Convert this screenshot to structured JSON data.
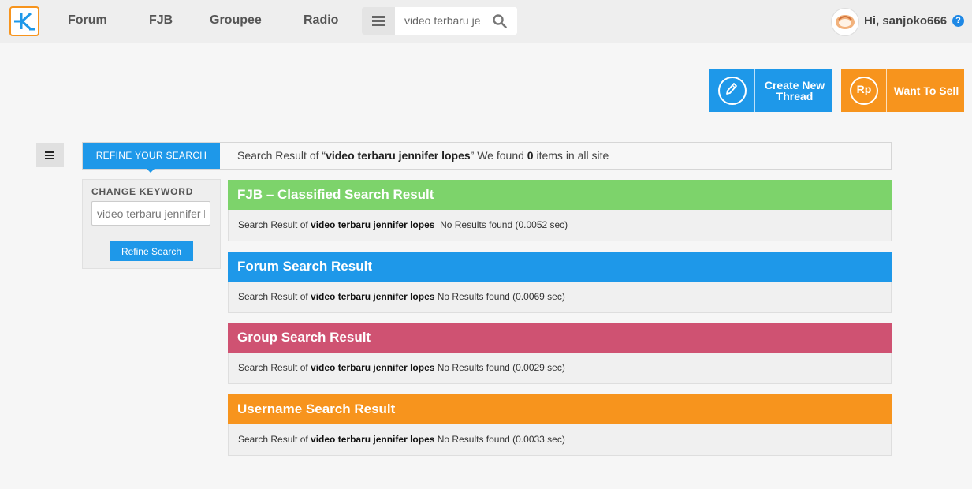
{
  "nav": {
    "logo_label": "K",
    "items": [
      "Forum",
      "FJB",
      "Groupee",
      "Radio"
    ],
    "search_value": "video terbaru je",
    "user_greeting": "Hi, sanjoko666",
    "help_label": "?"
  },
  "actions": {
    "create_line1": "Create New",
    "create_line2": "Thread",
    "sell_label": "Want To Sell",
    "sell_icon_text": "Rp"
  },
  "refine": {
    "tab_label": "REFINE YOUR SEARCH",
    "summary_prefix": "Search Result of “",
    "query": "video terbaru jennifer lopes",
    "summary_mid": "” We found ",
    "count": "0",
    "summary_suffix": " items in all site",
    "change_keyword_label": "CHANGE KEYWORD",
    "keyword_value": "video terbaru jennifer lopes",
    "button_label": "Refine Search"
  },
  "sections": [
    {
      "title": "FJB – Classified Search Result",
      "color": "#7dd36b",
      "prefix": "Search Result of ",
      "query": "video terbaru jennifer lopes",
      "status": "  No Results found (0.0052 sec)"
    },
    {
      "title": "Forum Search Result",
      "color": "#1e98e9",
      "prefix": "Search Result of ",
      "query": "video terbaru jennifer lopes",
      "status": " No Results found (0.0069 sec)"
    },
    {
      "title": "Group Search Result",
      "color": "#cf5272",
      "prefix": "Search Result of ",
      "query": "video terbaru jennifer lopes",
      "status": " No Results found (0.0029 sec)"
    },
    {
      "title": "Username Search Result",
      "color": "#f7941d",
      "prefix": "Search Result of ",
      "query": "video terbaru jennifer lopes",
      "status": " No Results found (0.0033 sec)"
    }
  ]
}
